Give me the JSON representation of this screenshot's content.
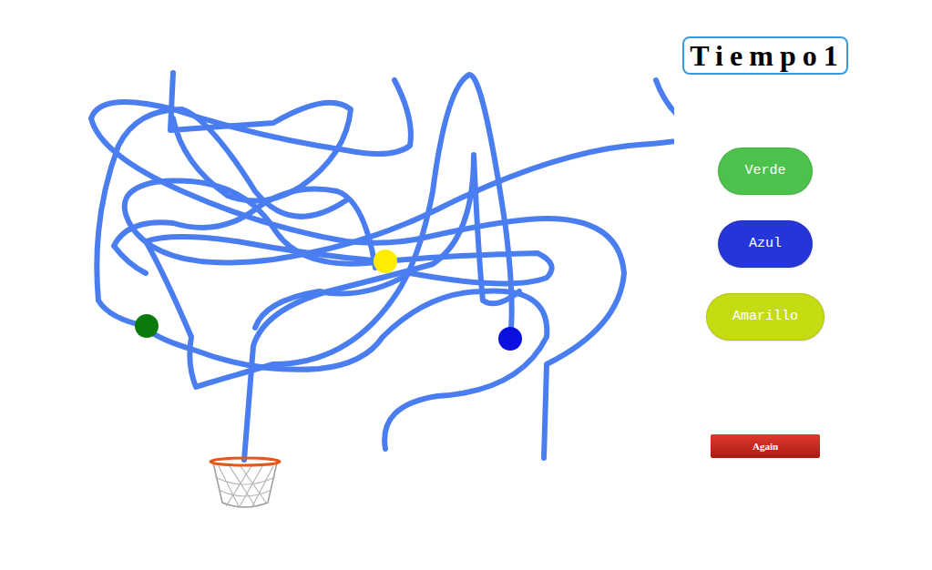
{
  "timer": {
    "label": "Tiempo1"
  },
  "balls": [
    {
      "color": "#0a7a0a"
    },
    {
      "color": "#ffee00"
    },
    {
      "color": "#0a10e0"
    }
  ],
  "answer_buttons": [
    {
      "label": "Verde",
      "color": "#4cc24c"
    },
    {
      "label": "Azul",
      "color": "#2536d8"
    },
    {
      "label": "Amarillo",
      "color": "#c6dc12"
    }
  ],
  "again_button": {
    "label": "Again"
  }
}
